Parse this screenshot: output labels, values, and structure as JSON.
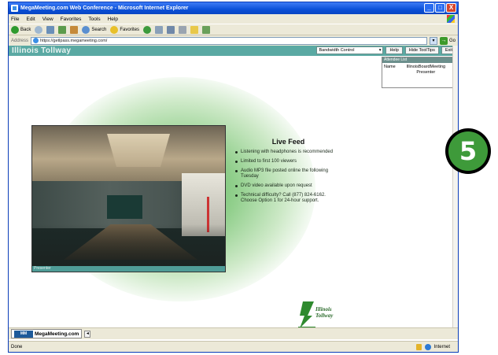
{
  "window": {
    "title": "MegaMeeting.com Web Conference - Microsoft Internet Explorer",
    "controls": [
      "_",
      "□",
      "X"
    ]
  },
  "menubar": {
    "items": [
      "File",
      "Edit",
      "View",
      "Favorites",
      "Tools",
      "Help"
    ]
  },
  "toolbar": {
    "back": "Back",
    "search": "Search",
    "favorites": "Favorites"
  },
  "addressbar": {
    "label": "Address",
    "url": "https://getlpass.megameeting.com/",
    "go": "Go"
  },
  "page": {
    "brand": "Illinois Tollway",
    "bandwidth_select": "Bandwidth Control",
    "help_button": "Help",
    "hide_tooltips_button": "Hide ToolTips",
    "exit_button": "Exit",
    "tooltips_panel": {
      "title": "Attendee List",
      "name": "Name",
      "value": "IllinoisBoardMeeting Presenter"
    },
    "video_label": "Presenter",
    "feed": {
      "title": "Live Feed",
      "bullets": [
        "Listening with headphones is recommended",
        "Limited to first 100 viewers",
        "Audio MP3 file posted online the following Tuesday",
        "DVD video available upon request",
        "Technical difficulty? Call (877) 824-6162. Choose Option 1 for 24-hour support."
      ]
    },
    "logo_line1": "Illinois",
    "logo_line2": "Tollway"
  },
  "taskbar": {
    "tab_label": "MegaMeeting.com",
    "logo_text": "MM"
  },
  "statusbar": {
    "left": "Done",
    "zone": "Internet"
  },
  "badge": {
    "number": "5"
  },
  "colors": {
    "header_teal": "#5aa9a3",
    "badge_green": "#3e9a3a",
    "title_blue": "#0a50d8"
  }
}
